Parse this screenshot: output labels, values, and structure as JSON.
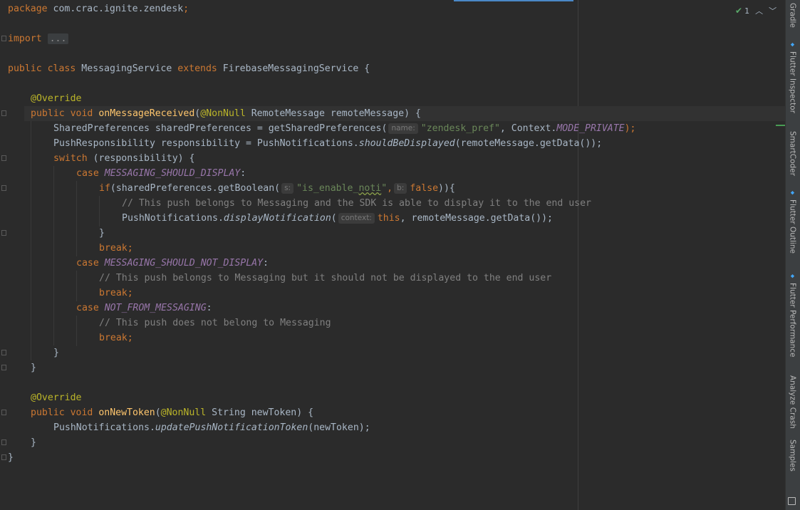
{
  "inspection": {
    "count": "1",
    "status_icon": "check-icon"
  },
  "toolwindows": [
    {
      "label": "Gradle",
      "icon": ""
    },
    {
      "label": "Flutter Inspector",
      "icon": "flutter-icon"
    },
    {
      "label": "SmartCoder",
      "icon": ""
    },
    {
      "label": "Flutter Outline",
      "icon": "flutter-icon"
    },
    {
      "label": "Flutter Performance",
      "icon": "flutter-icon"
    },
    {
      "label": "Analyze Crash",
      "icon": ""
    },
    {
      "label": "Samples",
      "icon": ""
    }
  ],
  "code": {
    "l1": {
      "kw": "package",
      "pkg": " com.crac.ignite.zendesk",
      "semi": ";"
    },
    "l3": {
      "kw": "import",
      "folded": "..."
    },
    "l5": {
      "kw1": "public",
      "kw2": "class",
      "name": "MessagingService",
      "kw3": "extends",
      "super": "FirebaseMessagingService {"
    },
    "l7": {
      "ann": "@Override"
    },
    "l8": {
      "kw1": "public",
      "kw2": "void",
      "fn": "onMessageReceived",
      "p1": "(",
      "ann": "@NonNull",
      "rest": " RemoteMessage remoteMessage) {"
    },
    "l9": {
      "a": "SharedPreferences sharedPreferences = getSharedPreferences(",
      "hint": "name:",
      "str": "\"zendesk_pref\"",
      "b": ", Context.",
      "field": "MODE_PRIVATE",
      "c": ");"
    },
    "l10": {
      "a": "PushResponsibility responsibility = PushNotifications.",
      "method": "shouldBeDisplayed",
      "b": "(remoteMessage.getData());"
    },
    "l11": {
      "kw": "switch",
      "rest": " (responsibility) {"
    },
    "l12": {
      "kw": "case",
      "field": "MESSAGING_SHOULD_DISPLAY",
      "rest": ":"
    },
    "l13": {
      "kw": "if",
      "a": "(sharedPreferences.getBoolean(",
      "hint1": "s:",
      "str_a": "\"is_enable_",
      "str_b": "noti",
      "str_c": "\"",
      "comma": ",",
      "hint2": "b:",
      "kw2": "false",
      "b": ")){"
    },
    "l14": {
      "comment": "// This push belongs to Messaging and the SDK is able to display it to the end user"
    },
    "l15": {
      "a": "PushNotifications.",
      "method": "displayNotification",
      "p": "(",
      "hint": "context:",
      "kw": "this",
      "b": ", remoteMessage.getData());"
    },
    "l16": {
      "text": "}"
    },
    "l17": {
      "kw": "break",
      "semi": ";"
    },
    "l18": {
      "kw": "case",
      "field": "MESSAGING_SHOULD_NOT_DISPLAY",
      "rest": ":"
    },
    "l19": {
      "comment": "// This push belongs to Messaging but it should not be displayed to the end user"
    },
    "l20": {
      "kw": "break",
      "semi": ";"
    },
    "l21": {
      "kw": "case",
      "field": "NOT_FROM_MESSAGING",
      "rest": ":"
    },
    "l22": {
      "comment": "// This push does not belong to Messaging"
    },
    "l23": {
      "kw": "break",
      "semi": ";"
    },
    "l24": {
      "text": "}"
    },
    "l25": {
      "text": "}"
    },
    "l27": {
      "ann": "@Override"
    },
    "l28": {
      "kw1": "public",
      "kw2": "void",
      "fn": "onNewToken",
      "p1": "(",
      "ann": "@NonNull",
      "rest": " String newToken) {"
    },
    "l29": {
      "a": "PushNotifications.",
      "method": "updatePushNotificationToken",
      "b": "(newToken);"
    },
    "l30": {
      "text": "}"
    },
    "l31": {
      "text": "}"
    }
  }
}
